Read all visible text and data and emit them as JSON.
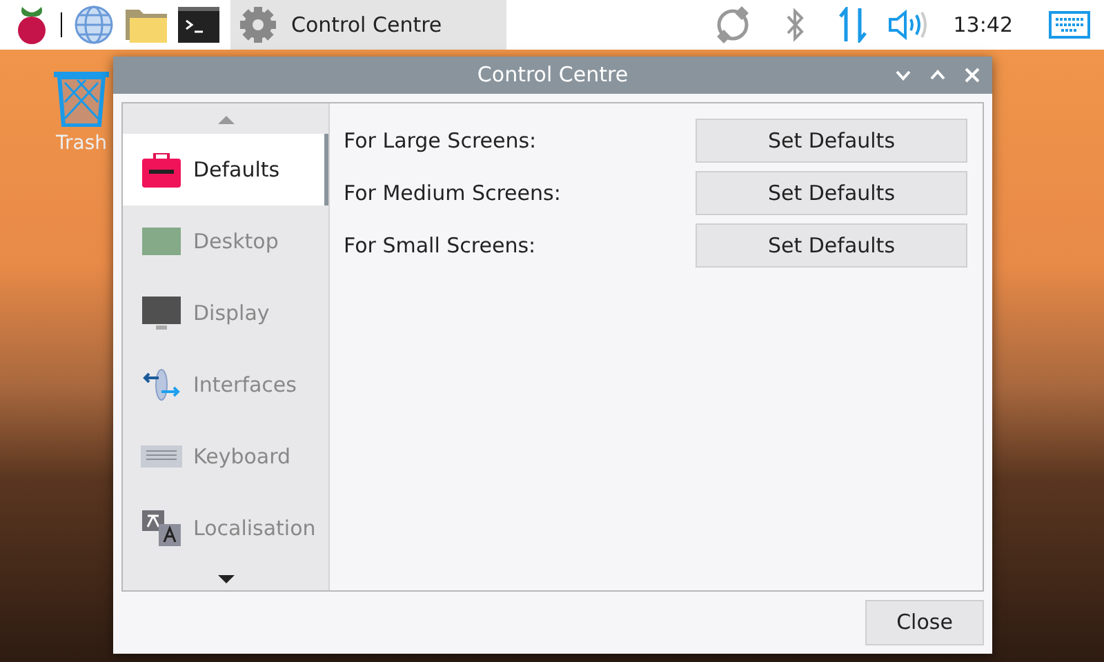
{
  "taskbar": {
    "task": {
      "label": "Control Centre",
      "selected": true
    },
    "clock": "13:42"
  },
  "desktop": {
    "icons": [
      {
        "label": "Trash"
      }
    ]
  },
  "window": {
    "title": "Control Centre",
    "sidebar": {
      "items": [
        {
          "label": "Defaults",
          "selected": true
        },
        {
          "label": "Desktop",
          "selected": false
        },
        {
          "label": "Display",
          "selected": false
        },
        {
          "label": "Interfaces",
          "selected": false
        },
        {
          "label": "Keyboard",
          "selected": false
        },
        {
          "label": "Localisation",
          "selected": false
        }
      ]
    },
    "rows": [
      {
        "label": "For Large Screens:",
        "button": "Set Defaults"
      },
      {
        "label": "For Medium Screens:",
        "button": "Set Defaults"
      },
      {
        "label": "For Small Screens:",
        "button": "Set Defaults"
      }
    ],
    "buttons": [
      "Close"
    ]
  }
}
